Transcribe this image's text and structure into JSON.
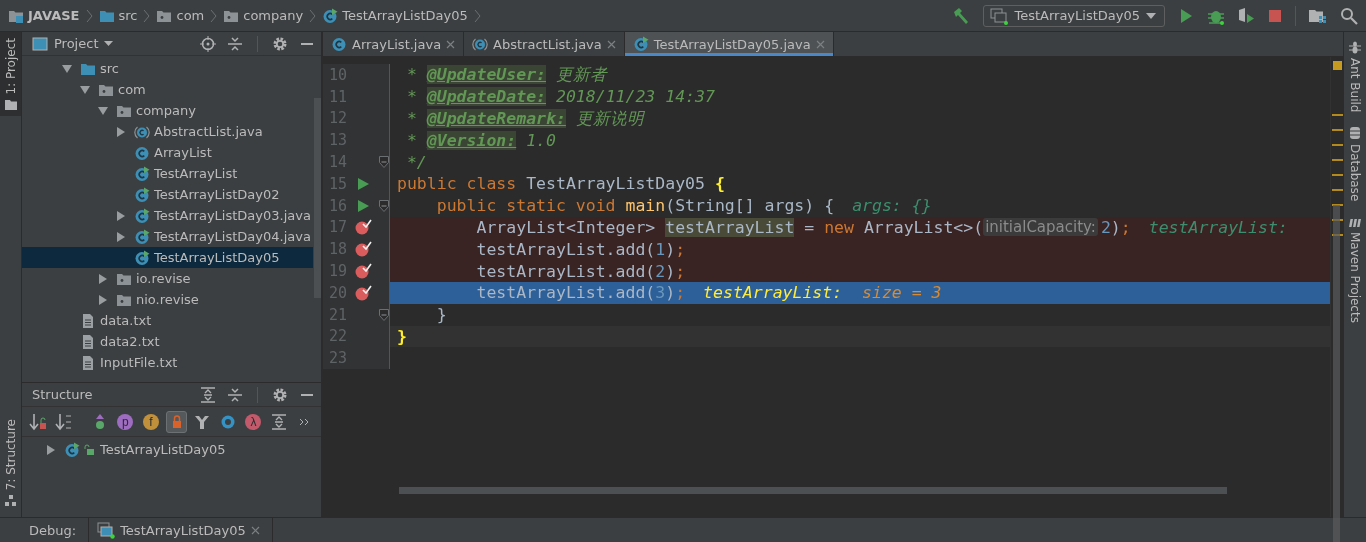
{
  "breadcrumbs": [
    {
      "label": "JAVASE",
      "kind": "project"
    },
    {
      "label": "src",
      "kind": "folder-src"
    },
    {
      "label": "com",
      "kind": "package"
    },
    {
      "label": "company",
      "kind": "package"
    },
    {
      "label": "TestArrayListDay05",
      "kind": "runnable"
    }
  ],
  "run_config": {
    "label": "TestArrayListDay05"
  },
  "left_strip": [
    {
      "label": "1: Project",
      "kind": "project",
      "selected": true
    },
    {
      "label": "7: Structure",
      "kind": "structure",
      "selected": false
    }
  ],
  "right_strip": [
    {
      "label": "Ant Build",
      "kind": "ant"
    },
    {
      "label": "Database",
      "kind": "database"
    },
    {
      "label": "Maven Projects",
      "kind": "maven"
    }
  ],
  "project_panel": {
    "title": "Project",
    "tree": [
      {
        "label": "src",
        "kind": "folder-src",
        "selected": false,
        "expanded": true,
        "children": [
          {
            "label": "com",
            "kind": "package",
            "selected": false,
            "expanded": true,
            "children": [
              {
                "label": "company",
                "kind": "package",
                "selected": false,
                "expanded": true,
                "children": [
                  {
                    "label": "AbstractList.java",
                    "kind": "abstract",
                    "selected": false,
                    "expanded": false
                  },
                  {
                    "label": "ArrayList",
                    "kind": "class",
                    "selected": false
                  },
                  {
                    "label": "TestArrayList",
                    "kind": "runnable",
                    "selected": false
                  },
                  {
                    "label": "TestArrayListDay02",
                    "kind": "runnable",
                    "selected": false
                  },
                  {
                    "label": "TestArrayListDay03.java",
                    "kind": "runnable",
                    "selected": false,
                    "expanded": false
                  },
                  {
                    "label": "TestArrayListDay04.java",
                    "kind": "runnable",
                    "selected": false,
                    "expanded": false
                  },
                  {
                    "label": "TestArrayListDay05",
                    "kind": "runnable",
                    "selected": true
                  }
                ]
              },
              {
                "label": "io.revise",
                "kind": "package",
                "selected": false,
                "expanded": false
              },
              {
                "label": "nio.revise",
                "kind": "package",
                "selected": false,
                "expanded": false
              }
            ]
          }
        ]
      },
      {
        "label": "data.txt",
        "kind": "file",
        "selected": false
      },
      {
        "label": "data2.txt",
        "kind": "file",
        "selected": false
      },
      {
        "label": "InputFile.txt",
        "kind": "file",
        "selected": false
      }
    ]
  },
  "structure_panel": {
    "title": "Structure",
    "toolbar": [
      {
        "kind": "sort-visibility",
        "selected": false
      },
      {
        "kind": "sort-alpha",
        "selected": false
      },
      {
        "kind": "inherited",
        "selected": false
      },
      {
        "kind": "property",
        "glyph": "p",
        "selected": false
      },
      {
        "kind": "field",
        "glyph": "f",
        "selected": false
      },
      {
        "kind": "non-public",
        "selected": true
      },
      {
        "kind": "anonymous",
        "selected": false
      },
      {
        "kind": "lambda-outer",
        "selected": false
      },
      {
        "kind": "lambda",
        "glyph": "λ",
        "selected": false
      },
      {
        "kind": "expand",
        "selected": false
      },
      {
        "kind": "more",
        "selected": false
      }
    ],
    "tree": [
      {
        "label": "TestArrayListDay05",
        "kind": "runnable",
        "selected": false,
        "expanded": false
      }
    ]
  },
  "editor_tabs": [
    {
      "label": "ArrayList.java",
      "kind": "class",
      "selected": false
    },
    {
      "label": "AbstractList.java",
      "kind": "abstract",
      "selected": false
    },
    {
      "label": "TestArrayListDay05.java",
      "kind": "runnable",
      "selected": true
    }
  ],
  "code_lines": [
    {
      "number": "10",
      "run_marker": false,
      "breakpoint": false,
      "execution_point": false,
      "caret_line": false,
      "fold": false,
      "segments": [
        {
          "kind": "code",
          "tokens": [
            {
              "text": " * ",
              "kind": "comment"
            },
            {
              "text": "@UpdateUser:",
              "kind": "tag"
            },
            {
              "text": " 更新者",
              "kind": "comment"
            }
          ]
        }
      ]
    },
    {
      "number": "11",
      "run_marker": false,
      "breakpoint": false,
      "execution_point": false,
      "caret_line": false,
      "fold": false,
      "segments": [
        {
          "kind": "code",
          "tokens": [
            {
              "text": " * ",
              "kind": "comment"
            },
            {
              "text": "@UpdateDate:",
              "kind": "tag"
            },
            {
              "text": " 2018/11/23 14:37",
              "kind": "comment"
            }
          ]
        }
      ]
    },
    {
      "number": "12",
      "run_marker": false,
      "breakpoint": false,
      "execution_point": false,
      "caret_line": false,
      "fold": false,
      "segments": [
        {
          "kind": "code",
          "tokens": [
            {
              "text": " * ",
              "kind": "comment"
            },
            {
              "text": "@UpdateRemark:",
              "kind": "tag"
            },
            {
              "text": " 更新说明",
              "kind": "comment"
            }
          ]
        }
      ]
    },
    {
      "number": "13",
      "run_marker": false,
      "breakpoint": false,
      "execution_point": false,
      "caret_line": false,
      "fold": false,
      "segments": [
        {
          "kind": "code",
          "tokens": [
            {
              "text": " * ",
              "kind": "comment"
            },
            {
              "text": "@Version:",
              "kind": "tag"
            },
            {
              "text": " 1.0",
              "kind": "comment"
            }
          ]
        }
      ]
    },
    {
      "number": "14",
      "run_marker": false,
      "breakpoint": false,
      "execution_point": false,
      "caret_line": false,
      "fold": true,
      "segments": [
        {
          "kind": "code",
          "tokens": [
            {
              "text": " */",
              "kind": "comment"
            }
          ]
        }
      ]
    },
    {
      "number": "15",
      "run_marker": true,
      "breakpoint": false,
      "execution_point": false,
      "caret_line": false,
      "fold": false,
      "segments": [
        {
          "kind": "code",
          "tokens": [
            {
              "text": "public class ",
              "kind": "keyword"
            },
            {
              "text": "TestArrayListDay05 ",
              "kind": "plain"
            },
            {
              "text": "{",
              "kind": "brace"
            }
          ]
        }
      ]
    },
    {
      "number": "16",
      "run_marker": true,
      "breakpoint": false,
      "execution_point": false,
      "caret_line": false,
      "fold": true,
      "segments": [
        {
          "kind": "code",
          "tokens": [
            {
              "text": "    public static void ",
              "kind": "keyword"
            },
            {
              "text": "main",
              "kind": "method"
            },
            {
              "text": "(String[] args) {",
              "kind": "plain"
            }
          ]
        },
        {
          "kind": "debug",
          "tokens": [
            {
              "text": "args: {}",
              "kind": "debug-name"
            }
          ]
        }
      ]
    },
    {
      "number": "17",
      "run_marker": false,
      "breakpoint": true,
      "execution_point": false,
      "caret_line": false,
      "fold": false,
      "segments": [
        {
          "kind": "code",
          "tokens": [
            {
              "text": "        ArrayList<Integer> ",
              "kind": "plain"
            },
            {
              "text": "testArrayList",
              "kind": "usage"
            },
            {
              "text": " = ",
              "kind": "plain"
            },
            {
              "text": "new ",
              "kind": "keyword"
            },
            {
              "text": "ArrayList<>(",
              "kind": "plain"
            }
          ]
        },
        {
          "kind": "hint",
          "tokens": [
            {
              "text": "initialCapacity:",
              "kind": "hint"
            }
          ]
        },
        {
          "kind": "code",
          "tokens": [
            {
              "text": "2",
              "kind": "number"
            },
            {
              "text": ")",
              "kind": "plain"
            },
            {
              "text": ";",
              "kind": "keyword"
            }
          ]
        },
        {
          "kind": "debug",
          "tokens": [
            {
              "text": "testArrayList:",
              "kind": "debug-name"
            }
          ]
        }
      ]
    },
    {
      "number": "18",
      "run_marker": false,
      "breakpoint": true,
      "execution_point": false,
      "caret_line": false,
      "fold": false,
      "segments": [
        {
          "kind": "code",
          "tokens": [
            {
              "text": "        testArrayList.add(",
              "kind": "plain"
            },
            {
              "text": "1",
              "kind": "number"
            },
            {
              "text": ")",
              "kind": "plain"
            },
            {
              "text": ";",
              "kind": "keyword"
            }
          ]
        }
      ]
    },
    {
      "number": "19",
      "run_marker": false,
      "breakpoint": true,
      "execution_point": false,
      "caret_line": false,
      "fold": false,
      "segments": [
        {
          "kind": "code",
          "tokens": [
            {
              "text": "        testArrayList.add(",
              "kind": "plain"
            },
            {
              "text": "2",
              "kind": "number"
            },
            {
              "text": ")",
              "kind": "plain"
            },
            {
              "text": ";",
              "kind": "keyword"
            }
          ]
        }
      ]
    },
    {
      "number": "20",
      "run_marker": false,
      "breakpoint": true,
      "execution_point": true,
      "caret_line": false,
      "fold": false,
      "segments": [
        {
          "kind": "code",
          "tokens": [
            {
              "text": "        testArrayList.add(",
              "kind": "plain"
            },
            {
              "text": "3",
              "kind": "number"
            },
            {
              "text": ")",
              "kind": "plain"
            },
            {
              "text": ";",
              "kind": "keyword"
            }
          ]
        },
        {
          "kind": "debug",
          "tokens": [
            {
              "text": "testArrayList:",
              "kind": "debug-current"
            },
            {
              "text": "  size = 3",
              "kind": "debug-value"
            }
          ]
        }
      ]
    },
    {
      "number": "21",
      "run_marker": false,
      "breakpoint": false,
      "execution_point": false,
      "caret_line": false,
      "fold": true,
      "segments": [
        {
          "kind": "code",
          "tokens": [
            {
              "text": "    }",
              "kind": "plain"
            }
          ]
        }
      ]
    },
    {
      "number": "22",
      "run_marker": false,
      "breakpoint": false,
      "execution_point": false,
      "caret_line": true,
      "fold": false,
      "segments": [
        {
          "kind": "code",
          "tokens": [
            {
              "text": "}",
              "kind": "brace"
            }
          ]
        }
      ]
    },
    {
      "number": "23",
      "run_marker": false,
      "breakpoint": false,
      "execution_point": false,
      "caret_line": false,
      "fold": false
    }
  ],
  "debug_bar": {
    "label": "Debug:",
    "tab": "TestArrayListDay05"
  }
}
